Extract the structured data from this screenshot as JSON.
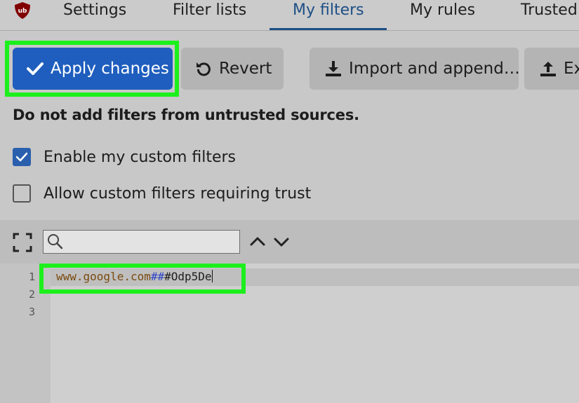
{
  "tabs": [
    {
      "label": "Settings",
      "active": false
    },
    {
      "label": "Filter lists",
      "active": false
    },
    {
      "label": "My filters",
      "active": true
    },
    {
      "label": "My rules",
      "active": false
    },
    {
      "label": "Trusted",
      "active": false
    }
  ],
  "logo": {
    "icon": "ublock-origin-shield-icon",
    "color": "#800000"
  },
  "buttons": {
    "apply": {
      "label": "Apply changes",
      "icon": "checkmark-icon"
    },
    "revert": {
      "label": "Revert",
      "icon": "undo-icon"
    },
    "import": {
      "label": "Import and append…",
      "icon": "download-icon"
    },
    "export": {
      "label": "Ex",
      "icon": "upload-icon"
    }
  },
  "notice": "Do not add filters from untrusted sources.",
  "options": [
    {
      "label": "Enable my custom filters",
      "checked": true
    },
    {
      "label": "Allow custom filters requiring trust",
      "checked": false
    }
  ],
  "editor_toolbar": {
    "fullscreen_icon": "fullscreen-icon",
    "search_value": "",
    "search_icon": "search-icon",
    "prev_icon": "chevron-up-icon",
    "next_icon": "chevron-down-icon"
  },
  "editor": {
    "line_numbers": [
      "1",
      "2",
      "3"
    ],
    "line1": {
      "host": "www.google.com",
      "separator": "##",
      "selector": "#Odp5De"
    }
  },
  "colors": {
    "accent": "#1e4f86",
    "primary_button": "#1f5ebe",
    "highlight": "#1cf01c",
    "checkbox_on": "#2a5fae"
  }
}
